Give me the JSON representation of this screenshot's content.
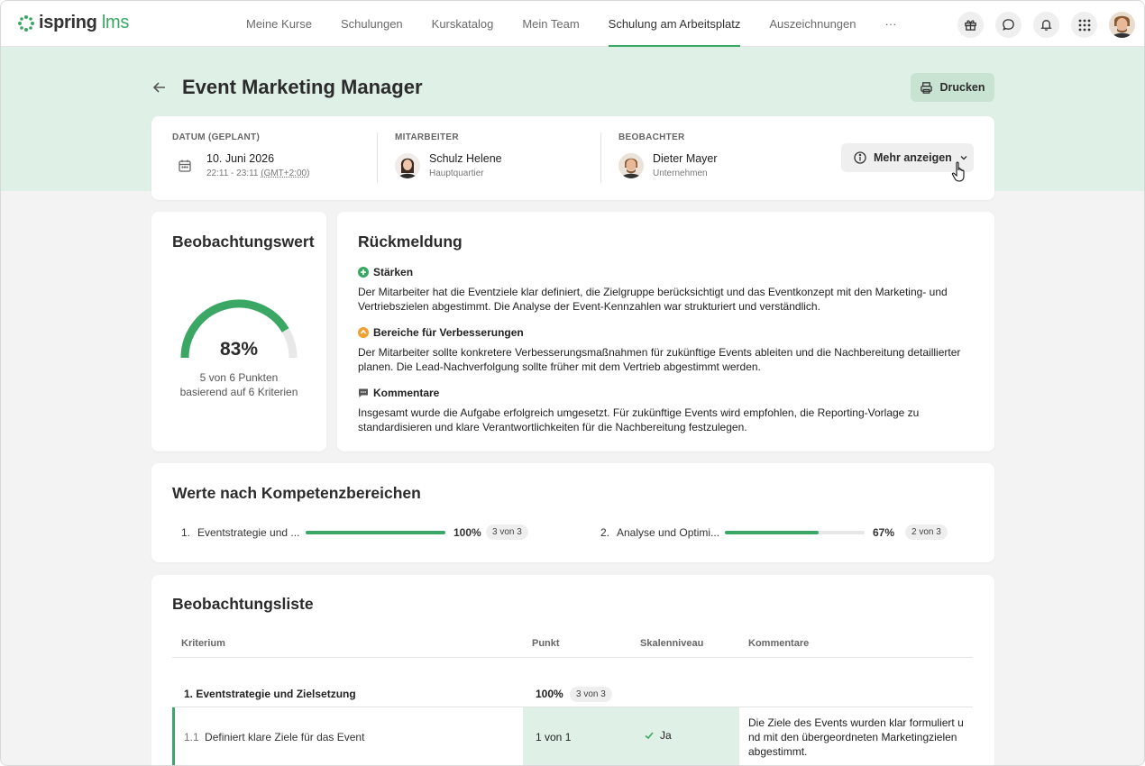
{
  "app": {
    "logo_main": "ispring",
    "logo_suffix": "lms"
  },
  "nav": {
    "items": [
      "Meine Kurse",
      "Schulungen",
      "Kurskatalog",
      "Mein Team",
      "Schulung am Arbeitsplatz",
      "Auszeichnungen"
    ],
    "more": "···",
    "active_index": 4
  },
  "header": {
    "title": "Event Marketing Manager",
    "print_label": "Drucken"
  },
  "info": {
    "date_label": "DATUM (GEPLANT)",
    "date": "10. Juni 2026",
    "time": "22:11 - 23:11",
    "timezone": "(GMT+2:00)",
    "employee_label": "MITARBEITER",
    "employee_name": "Schulz Helene",
    "employee_dept": "Hauptquartier",
    "observer_label": "BEOBACHTER",
    "observer_name": "Dieter Mayer",
    "observer_dept": "Unternehmen",
    "more_label": "Mehr anzeigen"
  },
  "score": {
    "title": "Beobachtungswert",
    "percent": "83%",
    "percent_value": 0.83,
    "line1": "5 von 6 Punkten",
    "line2": "basierend auf 6 Kriterien"
  },
  "feedback": {
    "title": "Rückmeldung",
    "strengths_label": "Stärken",
    "strengths_text": "Der Mitarbeiter hat die Eventziele klar definiert, die Zielgruppe berücksichtigt und das Eventkonzept mit den Marketing- und Vertriebszielen abgestimmt. Die Analyse der Event-Kennzahlen war strukturiert und verständlich.",
    "improve_label": "Bereiche für Verbesserungen",
    "improve_text": "Der Mitarbeiter sollte konkretere Verbesserungsmaßnahmen für zukünftige Events ableiten und die Nachbereitung detaillierter planen. Die Lead-Nachverfolgung sollte früher mit dem Vertrieb abgestimmt werden.",
    "comments_label": "Kommentare",
    "comments_text": "Insgesamt wurde die Aufgabe erfolgreich umgesetzt. Für zukünftige Events wird empfohlen, die Reporting-Vorlage zu standardisieren und klare Verantwortlichkeiten für die Nachbereitung festzulegen."
  },
  "competency": {
    "title": "Werte nach Kompetenzbereichen",
    "items": [
      {
        "num": "1.",
        "name": "Eventstrategie und ...",
        "percent": "100%",
        "value": 1.0,
        "count": "3 von 3"
      },
      {
        "num": "2.",
        "name": "Analyse und Optimi...",
        "percent": "67%",
        "value": 0.67,
        "count": "2 von 3"
      }
    ]
  },
  "observation": {
    "title": "Beobachtungsliste",
    "columns": [
      "Kriterium",
      "Punkt",
      "Skalenniveau",
      "Kommentare"
    ],
    "group": {
      "name": "1. Eventstrategie und Zielsetzung",
      "percent": "100%",
      "count": "3 von 3"
    },
    "row": {
      "num": "1.1",
      "name": "Definiert klare Ziele für das Event",
      "points": "1 von 1",
      "scale": "Ja",
      "comment": "Die Ziele des Events wurden klar formuliert u nd mit den übergeordneten Marketingzielen abgestimmt."
    }
  },
  "colors": {
    "accent": "#3aa864",
    "band": "#dff1e6",
    "orange": "#f0a030"
  }
}
